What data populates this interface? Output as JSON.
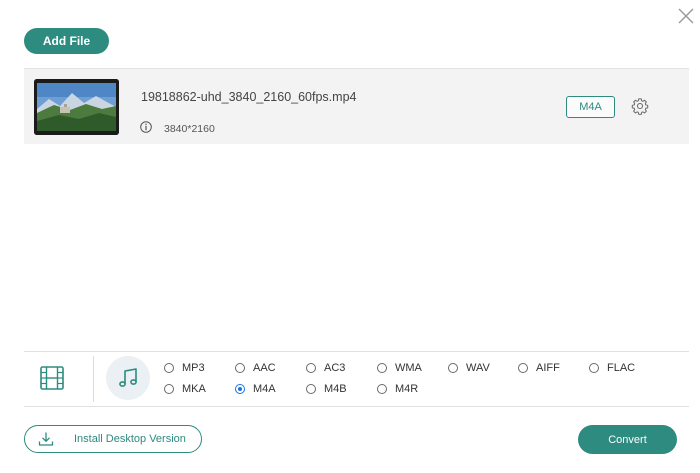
{
  "header": {
    "add_file_label": "Add File",
    "close_icon": "close-icon"
  },
  "file": {
    "name": "19818862-uhd_3840_2160_60fps.mp4",
    "resolution": "3840*2160",
    "output_format": "M4A",
    "info_icon": "info-icon",
    "settings_icon": "gear-icon"
  },
  "format_panel": {
    "tabs": [
      {
        "name": "video",
        "icon": "film-icon",
        "active": false
      },
      {
        "name": "audio",
        "icon": "music-note-icon",
        "active": true
      }
    ],
    "audio_formats": [
      {
        "label": "MP3",
        "selected": false
      },
      {
        "label": "AAC",
        "selected": false
      },
      {
        "label": "AC3",
        "selected": false
      },
      {
        "label": "WMA",
        "selected": false
      },
      {
        "label": "WAV",
        "selected": false
      },
      {
        "label": "AIFF",
        "selected": false
      },
      {
        "label": "FLAC",
        "selected": false
      },
      {
        "label": "MKA",
        "selected": false
      },
      {
        "label": "M4A",
        "selected": true
      },
      {
        "label": "M4B",
        "selected": false
      },
      {
        "label": "M4R",
        "selected": false
      }
    ]
  },
  "footer": {
    "install_label": "Install Desktop Version",
    "convert_label": "Convert"
  },
  "colors": {
    "accent": "#2d8b7f",
    "radio_selected": "#1a73e8",
    "row_background": "#f3f3f3"
  }
}
